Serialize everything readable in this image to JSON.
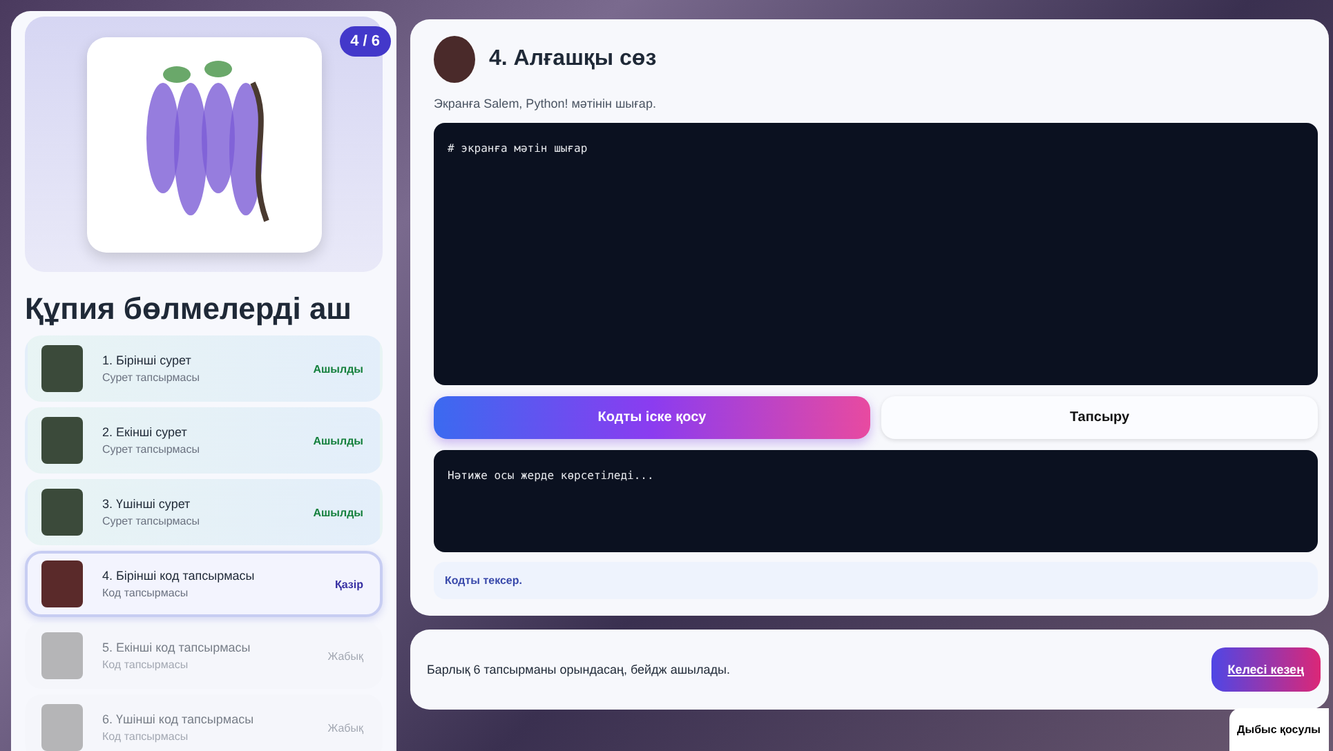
{
  "sidebar": {
    "progress_badge": "4 / 6",
    "title": "Құпия бөлмелерді аш",
    "tasks": [
      {
        "title": "1. Бірінші сурет",
        "subtitle": "Сурет тапсырмасы",
        "status": "Ашылды",
        "kind": "done"
      },
      {
        "title": "2. Екінші сурет",
        "subtitle": "Сурет тапсырмасы",
        "status": "Ашылды",
        "kind": "done"
      },
      {
        "title": "3. Үшінші сурет",
        "subtitle": "Сурет тапсырмасы",
        "status": "Ашылды",
        "kind": "done"
      },
      {
        "title": "4. Бірінші код тапсырмасы",
        "subtitle": "Код тапсырмасы",
        "status": "Қазір",
        "kind": "current"
      },
      {
        "title": "5. Екінші код тапсырмасы",
        "subtitle": "Код тапсырмасы",
        "status": "Жабық",
        "kind": "locked"
      },
      {
        "title": "6. Үшінші код тапсырмасы",
        "subtitle": "Код тапсырмасы",
        "status": "Жабық",
        "kind": "locked"
      }
    ]
  },
  "task": {
    "title": "4. Алғашқы сөз",
    "description": "Экранға Salem, Python! мәтінін шығар.",
    "code": "# экранға мәтін шығар",
    "run_button": "Кодты іске қосу",
    "submit_button": "Тапсыру",
    "output": "Нәтиже осы жерде көрсетіледі...",
    "hint": "Кодты тексер."
  },
  "footer": {
    "message": "Барлық 6 тапсырманы орындасаң, бейдж ашылады.",
    "next_button": "Келесі кезең",
    "sound_toggle": "Дыбыс қосулы"
  }
}
